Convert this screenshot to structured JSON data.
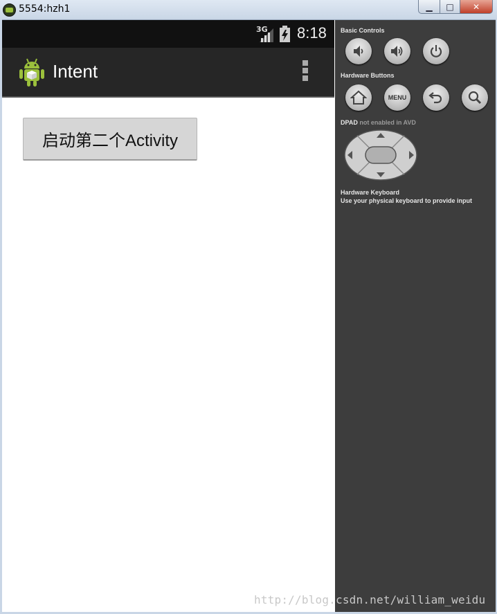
{
  "window": {
    "title": "5554:hzh1",
    "minimize_glyph": "▁",
    "maximize_glyph": "□",
    "close_glyph": "✕"
  },
  "statusbar": {
    "network": "3G",
    "time": "8:18"
  },
  "actionbar": {
    "title": "Intent",
    "logo_icon": "android-robot-icon",
    "overflow_icon": "overflow-menu-icon"
  },
  "content": {
    "launch_button_label": "启动第二个Activity"
  },
  "panel": {
    "basic_controls_label": "Basic Controls",
    "hardware_buttons_label": "Hardware Buttons",
    "dpad_label": "DPAD",
    "dpad_status": "not enabled in AVD",
    "keyboard_title": "Hardware Keyboard",
    "keyboard_hint": "Use your physical keyboard to provide input",
    "menu_label": "MENU"
  },
  "watermark": "http://blog.csdn.net/william_weidu",
  "colors": {
    "panel_bg": "#3d3d3d",
    "actionbar_bg": "#262626",
    "statusbar_bg": "#111111",
    "android_green": "#9bc03c"
  }
}
